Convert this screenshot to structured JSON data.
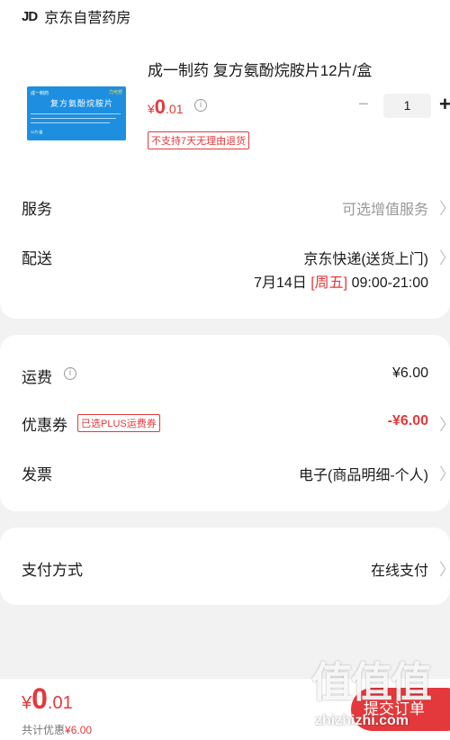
{
  "store": {
    "logo": "JD",
    "name": "京东自营药房"
  },
  "product": {
    "title": "成一制药 复方氨酚烷胺片12片/盒",
    "price_currency": "¥",
    "price_int": "0",
    "price_dec": ".01",
    "info_icon": "i",
    "no_return_tag": "不支持7天无理由退货",
    "quantity": "1",
    "minus_label": "−",
    "plus_label": "+",
    "thumbnail": {
      "brand": "成一制药",
      "brand_right": "力可舒",
      "name": "复方氨酚烷胺片",
      "count": "12片/盒"
    }
  },
  "service": {
    "label": "服务",
    "value": "可选增值服务"
  },
  "delivery": {
    "label": "配送",
    "method": "京东快递(送货上门)",
    "date": "7月14日",
    "weekday": "[周五]",
    "time": "09:00-21:00"
  },
  "freight": {
    "label": "运费",
    "value": "¥6.00"
  },
  "coupon": {
    "label": "优惠券",
    "tag": "已选PLUS运费券",
    "value": "-¥6.00"
  },
  "invoice": {
    "label": "发票",
    "value": "电子(商品明细-个人)"
  },
  "payment": {
    "label": "支付方式",
    "value": "在线支付"
  },
  "chevron": "〉",
  "footer": {
    "total_currency": "¥",
    "total_int": "0",
    "total_dec": ".01",
    "saved_label": "共计优惠",
    "saved_value": "¥6.00",
    "submit_label": "提交订单"
  },
  "watermark": {
    "glyphs": "值值值",
    "text": "zhizhizhi.com"
  },
  "colors": {
    "accent": "#e4393c",
    "background": "#f2f2f2",
    "card": "#ffffff",
    "thumbnail": "#1e8fe0"
  }
}
